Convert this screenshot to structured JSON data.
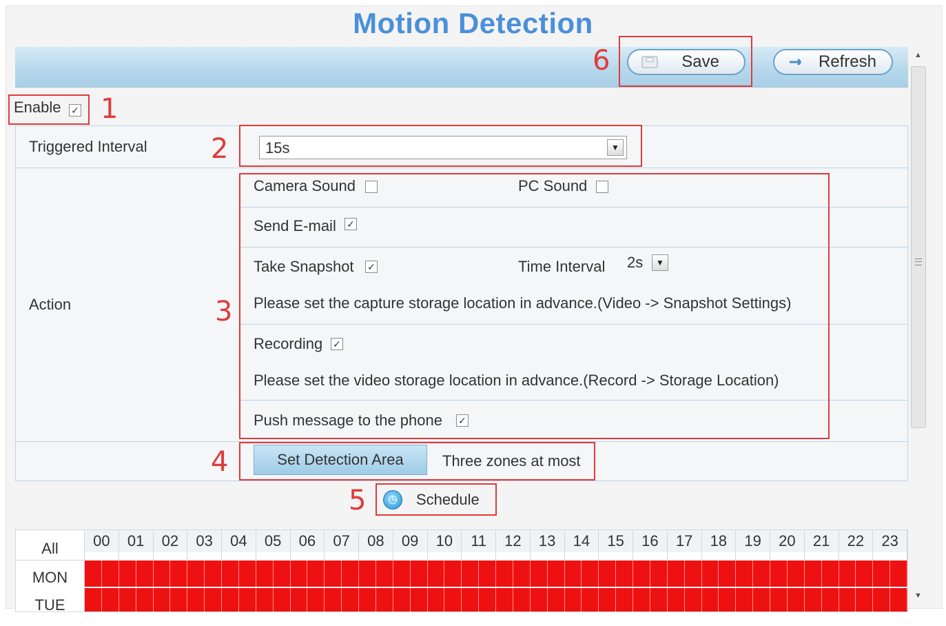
{
  "page": {
    "title": "Motion Detection"
  },
  "toolbar": {
    "save_label": "Save",
    "refresh_label": "Refresh"
  },
  "enable": {
    "label": "Enable",
    "checked": true
  },
  "triggered_interval": {
    "label": "Triggered Interval",
    "value": "15s"
  },
  "action": {
    "label": "Action",
    "camera_sound": {
      "label": "Camera Sound",
      "checked": false
    },
    "pc_sound": {
      "label": "PC Sound",
      "checked": false
    },
    "send_email": {
      "label": "Send E-mail",
      "checked": true
    },
    "take_snapshot": {
      "label": "Take Snapshot",
      "checked": true
    },
    "time_interval": {
      "label": "Time Interval",
      "value": "2s"
    },
    "snapshot_note": "Please set the capture storage location in advance.(Video -> Snapshot Settings)",
    "recording": {
      "label": "Recording",
      "checked": true
    },
    "recording_note": "Please set the video storage location in advance.(Record -> Storage Location)",
    "push_message": {
      "label": "Push message to the phone",
      "checked": true
    }
  },
  "detection_area": {
    "button_label": "Set Detection Area",
    "note": "Three zones at most"
  },
  "schedule": {
    "button_label": "Schedule",
    "all_label": "All",
    "hours": [
      "00",
      "01",
      "02",
      "03",
      "04",
      "05",
      "06",
      "07",
      "08",
      "09",
      "10",
      "11",
      "12",
      "13",
      "14",
      "15",
      "16",
      "17",
      "18",
      "19",
      "20",
      "21",
      "22",
      "23"
    ],
    "days": [
      "MON",
      "TUE"
    ],
    "selected_color": "#ee1111"
  },
  "annotations": {
    "enable": "1",
    "interval": "2",
    "action": "3",
    "area": "4",
    "schedule": "5",
    "save": "6"
  },
  "colors": {
    "title": "#4a90d9",
    "annotation": "#e03a3a",
    "toolbar": "#b7d8ec"
  }
}
